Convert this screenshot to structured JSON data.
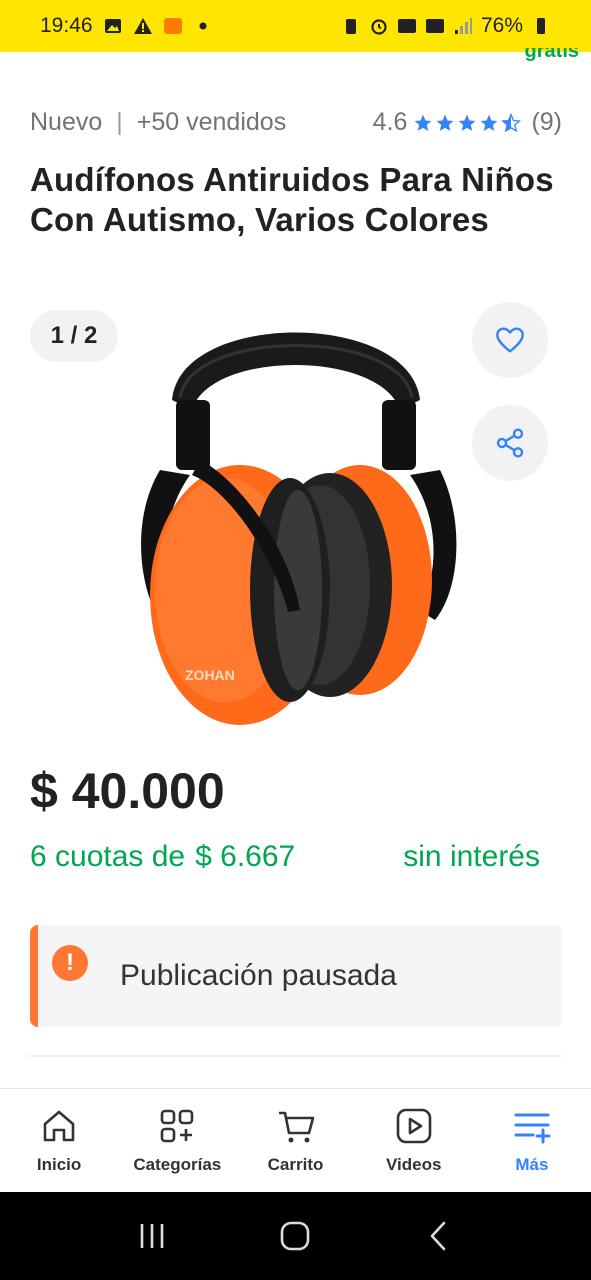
{
  "status_bar": {
    "time": "19:46",
    "battery": "76%"
  },
  "header_peek": "gratis",
  "product": {
    "condition": "Nuevo",
    "sold": "+50 vendidos",
    "rating": "4.6",
    "rating_stars": 4.5,
    "review_count": "(9)",
    "title": "Audífonos Antiruidos Para Niños Con Autismo, Varios Colores",
    "brand_on_image": "ZOHAN"
  },
  "gallery": {
    "counter": "1 / 2"
  },
  "price": {
    "amount": "$ 40.000",
    "installments_prefix": "6 cuotas de",
    "installment_amount": "$ 6.667",
    "installments_suffix": "sin interés"
  },
  "alert": {
    "message": "Publicación pausada"
  },
  "bottom_nav": {
    "items": [
      {
        "label": "Inicio"
      },
      {
        "label": "Categorías"
      },
      {
        "label": "Carrito"
      },
      {
        "label": "Videos"
      },
      {
        "label": "Más"
      }
    ]
  },
  "colors": {
    "accent_yellow": "#ffe600",
    "price_green": "#00a650",
    "star_blue": "#3483fa",
    "alert_orange": "#ff7733"
  }
}
